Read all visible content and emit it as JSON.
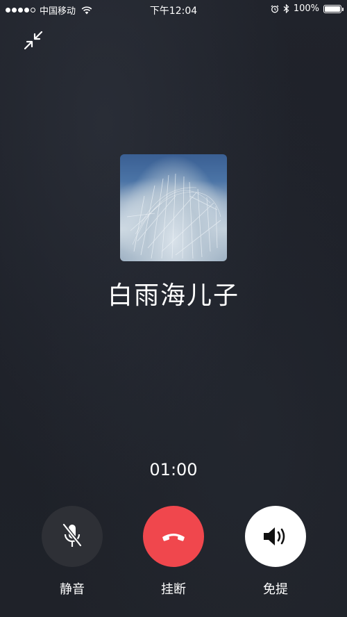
{
  "status_bar": {
    "carrier": "中国移动",
    "time": "下午12:04",
    "battery": "100%",
    "battery_level": 1.0
  },
  "call": {
    "caller_name": "白雨海儿子",
    "duration": "01:00"
  },
  "controls": {
    "mute_label": "静音",
    "hangup_label": "挂断",
    "speaker_label": "免提"
  },
  "colors": {
    "background": "#1f2128",
    "hangup": "#f0474d",
    "mute_bg": "#2e3036",
    "speaker_bg": "#ffffff"
  },
  "icons": {
    "minimize": "minimize-arrows-icon",
    "mute": "mic-off-icon",
    "hangup": "phone-hangup-icon",
    "speaker": "speaker-icon"
  }
}
